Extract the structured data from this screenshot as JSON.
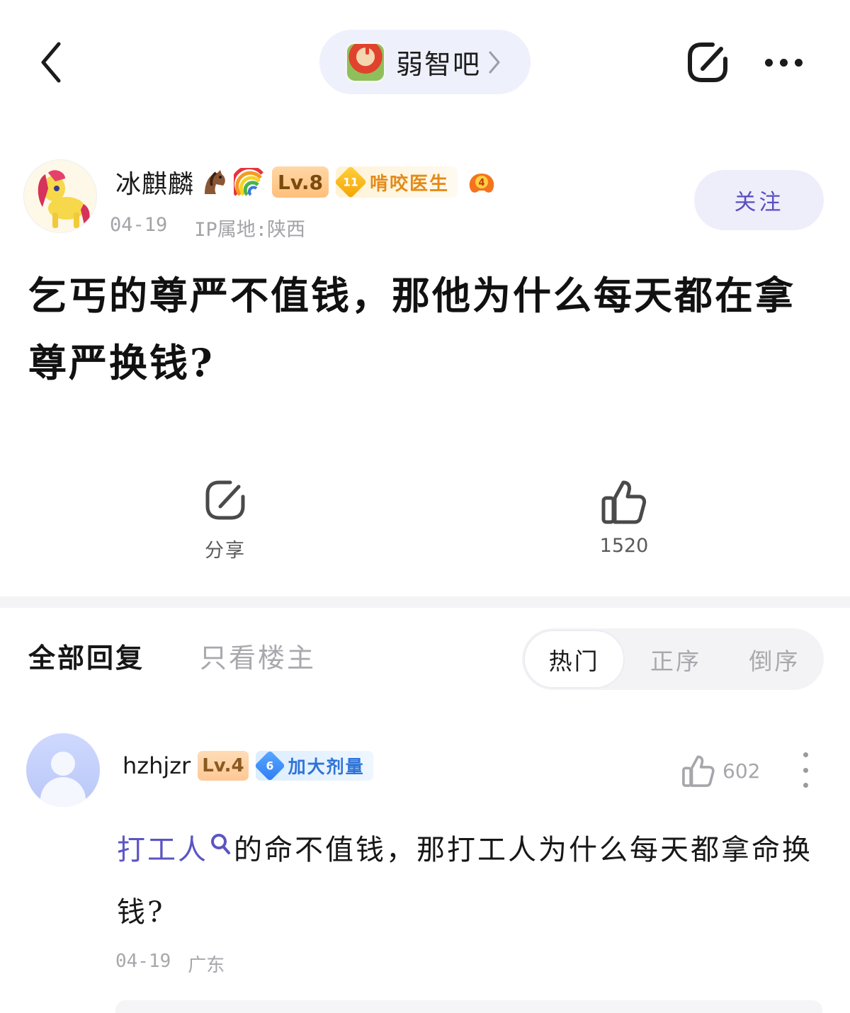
{
  "header": {
    "forum_name": "弱智吧"
  },
  "post": {
    "author_name": "冰麒麟",
    "author_level": "Lv.8",
    "badge_number": "11",
    "badge_title": "啃咬医生",
    "medal_number": "4",
    "date": "04-19",
    "ip_location": "IP属地:陕西",
    "follow_label": "关注",
    "title": "乞丐的尊严不值钱，那他为什么每天都在拿尊严换钱?"
  },
  "actions": {
    "share_label": "分享",
    "like_count": "1520"
  },
  "reply_tabs": {
    "all_label": "全部回复",
    "op_only_label": "只看楼主",
    "sort_options": [
      "热门",
      "正序",
      "倒序"
    ],
    "active_sort": "热门"
  },
  "comment": {
    "user_name": "hzhjzr",
    "level": "Lv.4",
    "badge_number": "6",
    "badge_title": "加大剂量",
    "like_count": "602",
    "link_text": "打工人",
    "body_text": "的命不值钱，那打工人为什么每天都拿命换钱?",
    "date": "04-19",
    "location": "广东"
  },
  "colors": {
    "accent": "#5b55c4",
    "pill_bg": "#eef0fb",
    "meta_gray": "#a3a3a8"
  },
  "icons": {
    "back": "chevron-left-icon",
    "forum_chevron": "chevron-right-icon",
    "share": "share-icon",
    "more": "more-horizontal-icon",
    "like": "thumbs-up-icon",
    "comment_more": "more-vertical-icon",
    "search": "search-icon"
  }
}
